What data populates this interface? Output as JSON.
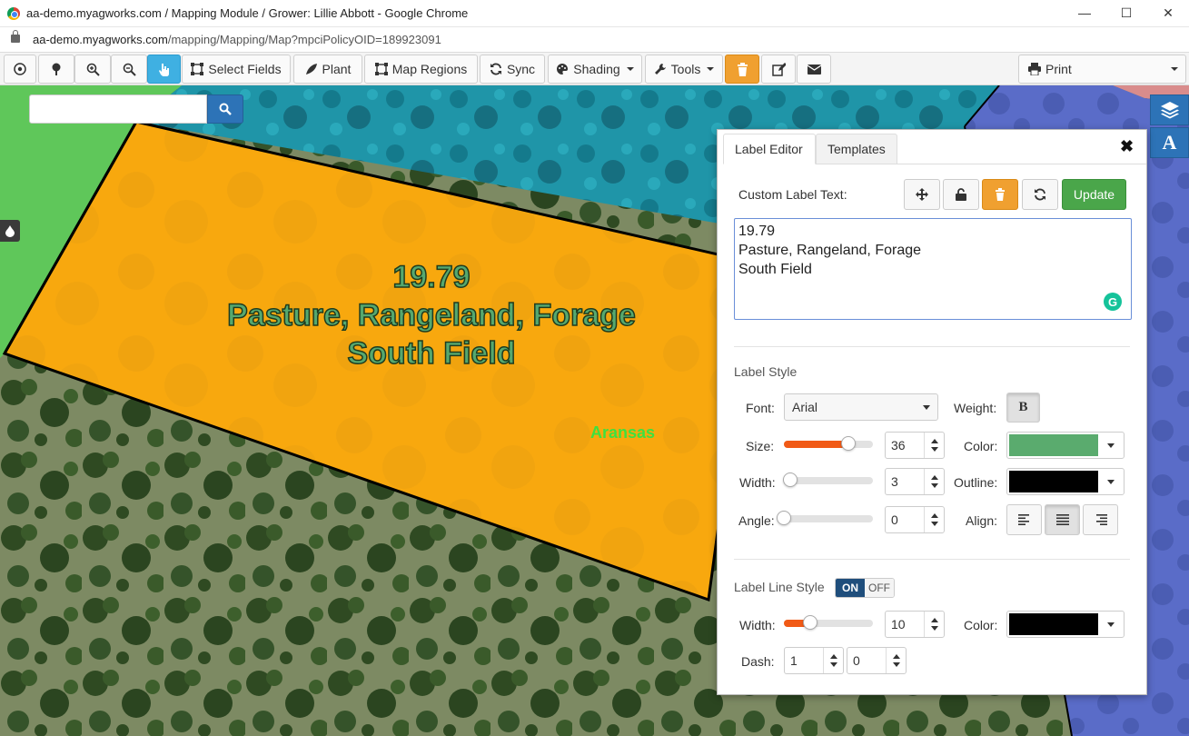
{
  "window": {
    "title": "aa-demo.myagworks.com / Mapping Module / Grower: Lillie Abbott - Google Chrome",
    "url_host": "aa-demo.myagworks.com",
    "url_path": "/mapping/Mapping/Map?mpciPolicyOID=189923091",
    "minimize": "—",
    "maximize": "☐",
    "close": "✕"
  },
  "toolbar": {
    "select_fields": "Select Fields",
    "plant": "Plant",
    "map_regions": "Map Regions",
    "sync": "Sync",
    "shading": "Shading",
    "tools": "Tools",
    "print": "Print"
  },
  "map": {
    "search_placeholder": "",
    "field_label_lines": [
      "19.79",
      "Pasture, Rangeland, Forage",
      "South Field"
    ],
    "region_label": "Aransas",
    "label_button": "A"
  },
  "label_editor": {
    "tabs": [
      "Label Editor",
      "Templates"
    ],
    "close": "✖",
    "custom_label_text_label": "Custom Label Text:",
    "update_button": "Update",
    "label_text": "19.79\nPasture, Rangeland, Forage\nSouth Field",
    "grammarly_badge": "G",
    "label_style": {
      "title": "Label Style",
      "font_label": "Font:",
      "font_value": "Arial",
      "weight_label": "Weight:",
      "weight_button": "B",
      "size_label": "Size:",
      "size_value": "36",
      "size_slider_fraction": 0.72,
      "color_label": "Color:",
      "color_value": "#5aab6e",
      "width_label": "Width:",
      "width_value": "3",
      "width_slider_fraction": 0.0,
      "outline_label": "Outline:",
      "outline_value": "#000000",
      "angle_label": "Angle:",
      "angle_value": "0",
      "angle_slider_fraction": 0.0,
      "align_label": "Align:",
      "align_selected": "center"
    },
    "label_line_style": {
      "title": "Label Line Style",
      "toggle_on": "ON",
      "toggle_off": "OFF",
      "width_label": "Width:",
      "width_value": "10",
      "width_slider_fraction": 0.3,
      "color_label": "Color:",
      "color_value": "#000000",
      "dash_label": "Dash:",
      "dash_value_1": "1",
      "dash_value_2": "0"
    }
  }
}
